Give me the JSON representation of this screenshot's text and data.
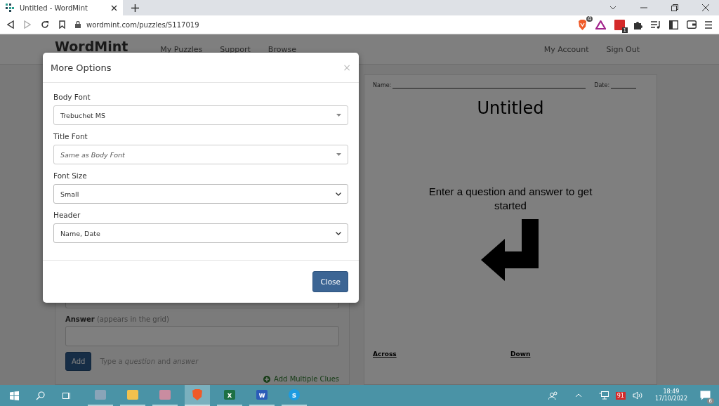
{
  "browser": {
    "tab": {
      "title": "Untitled - WordMint"
    },
    "address": "wordmint.com/puzzles/5117019",
    "badges": {
      "shield": "4",
      "extension": "1"
    }
  },
  "site": {
    "logo": "WordMint",
    "nav": [
      "My Puzzles",
      "Support",
      "Browse"
    ],
    "account": [
      "My Account",
      "Sign Out"
    ]
  },
  "editor": {
    "answer_label": "Answer",
    "answer_hint": "(appears in the grid)",
    "add_button": "Add",
    "hint": "Type a *question* and *answer*",
    "multiple_link": "Add Multiple Clues"
  },
  "preview": {
    "name_label": "Name:",
    "date_label": "Date:",
    "title": "Untitled",
    "message": "Enter a question and answer to get started",
    "across": "Across",
    "down": "Down"
  },
  "modal": {
    "title": "More Options",
    "close_glyph": "×",
    "fields": [
      {
        "label": "Body Font",
        "kind": "combo",
        "value": "Trebuchet MS"
      },
      {
        "label": "Title Font",
        "kind": "combo",
        "placeholder": "Same as Body Font"
      },
      {
        "label": "Font Size",
        "kind": "select",
        "value": "Small"
      },
      {
        "label": "Header",
        "kind": "select",
        "value": "Name, Date"
      }
    ],
    "button": "Close"
  },
  "taskbar": {
    "apps": [
      {
        "kind": "calculator",
        "selected": false
      },
      {
        "kind": "folder",
        "selected": false
      },
      {
        "kind": "snip",
        "selected": false
      },
      {
        "kind": "brave",
        "selected": true
      },
      {
        "kind": "excel",
        "selected": false,
        "letter": "x"
      },
      {
        "kind": "word",
        "selected": false,
        "letter": "w"
      },
      {
        "kind": "skype",
        "selected": false,
        "letter": "s"
      }
    ],
    "tray_badge": "91",
    "time": "18:49",
    "date": "17/10/2022",
    "notifications": "6"
  }
}
